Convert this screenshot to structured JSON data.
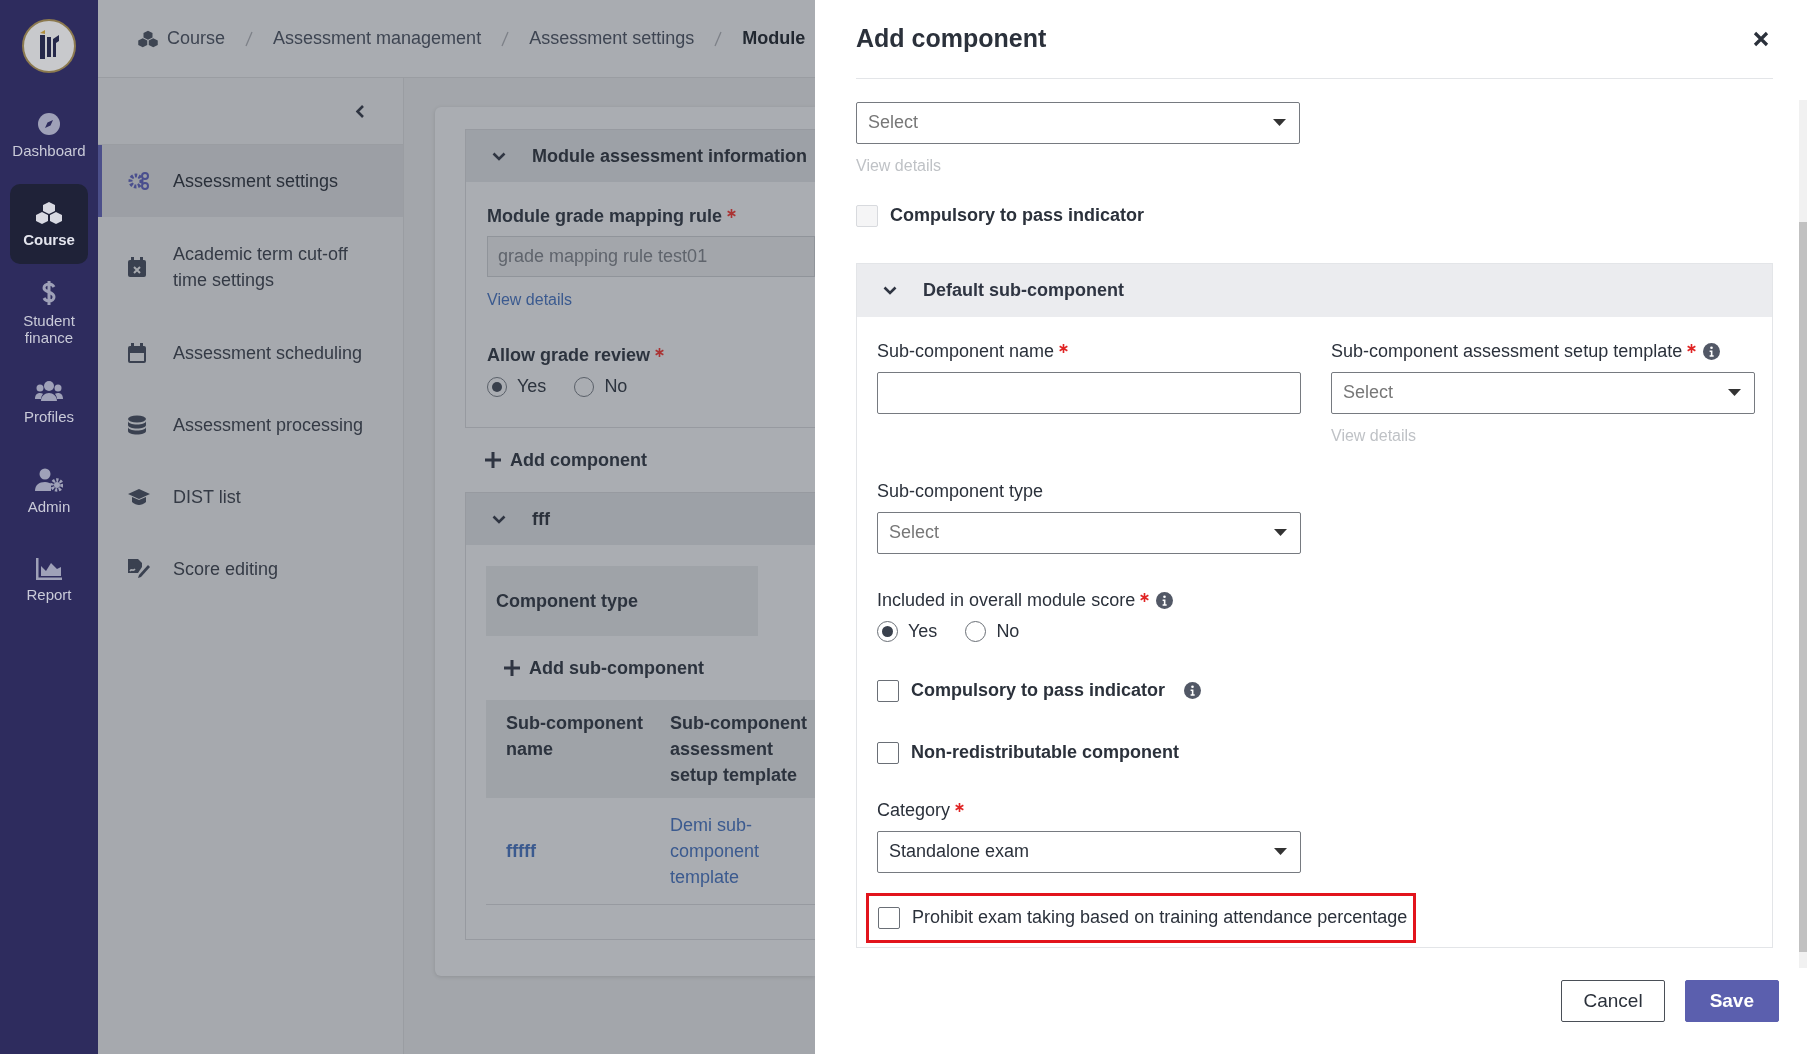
{
  "app_sidebar": {
    "items": [
      {
        "label": "Dashboard",
        "selected": false
      },
      {
        "label": "Course",
        "selected": true
      },
      {
        "label": "Student finance",
        "selected": false
      },
      {
        "label": "Profiles",
        "selected": false
      },
      {
        "label": "Admin",
        "selected": false
      },
      {
        "label": "Report",
        "selected": false
      }
    ]
  },
  "breadcrumbs": [
    {
      "label": "Course",
      "current": false
    },
    {
      "label": "Assessment management",
      "current": false
    },
    {
      "label": "Assessment settings",
      "current": false
    },
    {
      "label": "Module",
      "current": true
    }
  ],
  "section_nav": {
    "items": [
      {
        "label": "Assessment settings",
        "selected": true
      },
      {
        "label": "Academic term cut-off time settings",
        "selected": false
      },
      {
        "label": "Assessment scheduling",
        "selected": false
      },
      {
        "label": "Assessment processing",
        "selected": false
      },
      {
        "label": "DIST list",
        "selected": false
      },
      {
        "label": "Score editing",
        "selected": false
      }
    ]
  },
  "module_panel": {
    "title": "Module assessment information",
    "expanded": true,
    "grade_mapping_rule": {
      "label": "Module grade mapping rule",
      "required": true,
      "value": "grade mapping rule test01",
      "disabled": true
    },
    "view_details": "View details",
    "allow_grade_review": {
      "label": "Allow grade review",
      "required": true,
      "options": [
        {
          "label": "Yes",
          "selected": true
        },
        {
          "label": "No",
          "selected": false
        }
      ]
    },
    "add_component": "Add component",
    "component": {
      "title": "fff",
      "expanded": true,
      "component_type": "Component type",
      "add_sub_component": "Add sub-component",
      "table": {
        "columns": [
          "Sub-component name",
          "Sub-component assessment setup template"
        ],
        "rows": [
          [
            "fffff",
            "Demi sub-component template"
          ]
        ]
      }
    }
  },
  "dialog": {
    "title": "Add component",
    "grade_mapping_select": {
      "placeholder": "Select"
    },
    "view_details": {
      "label": "View details",
      "disabled": true
    },
    "compulsory": {
      "label": "Compulsory to pass indicator",
      "checked": false,
      "disabled": true
    },
    "sub_section": {
      "title": "Default sub-component",
      "expanded": true,
      "name_field": {
        "label": "Sub-component name",
        "required": true
      },
      "template_field": {
        "label": "Sub-component assessment setup template",
        "required": true,
        "info": true,
        "placeholder": "Select",
        "view_details": "View details"
      },
      "type_field": {
        "label": "Sub-component type",
        "placeholder": "Select"
      },
      "included": {
        "label": "Included in overall module score",
        "required": true,
        "info": true,
        "options": [
          {
            "label": "Yes",
            "selected": true
          },
          {
            "label": "No",
            "selected": false
          }
        ]
      },
      "checkboxes": [
        {
          "label": "Compulsory to pass indicator",
          "checked": false,
          "info": true
        },
        {
          "label": "Non-redistributable component",
          "checked": false,
          "info": false
        }
      ],
      "category": {
        "label": "Category",
        "required": true,
        "value": "Standalone exam"
      },
      "prohibit": {
        "label": "Prohibit exam taking based on training attendance percentage",
        "checked": false,
        "highlighted": true
      }
    },
    "buttons": [
      {
        "label": "Cancel",
        "kind": "secondary"
      },
      {
        "label": "Save",
        "kind": "primary"
      }
    ]
  }
}
